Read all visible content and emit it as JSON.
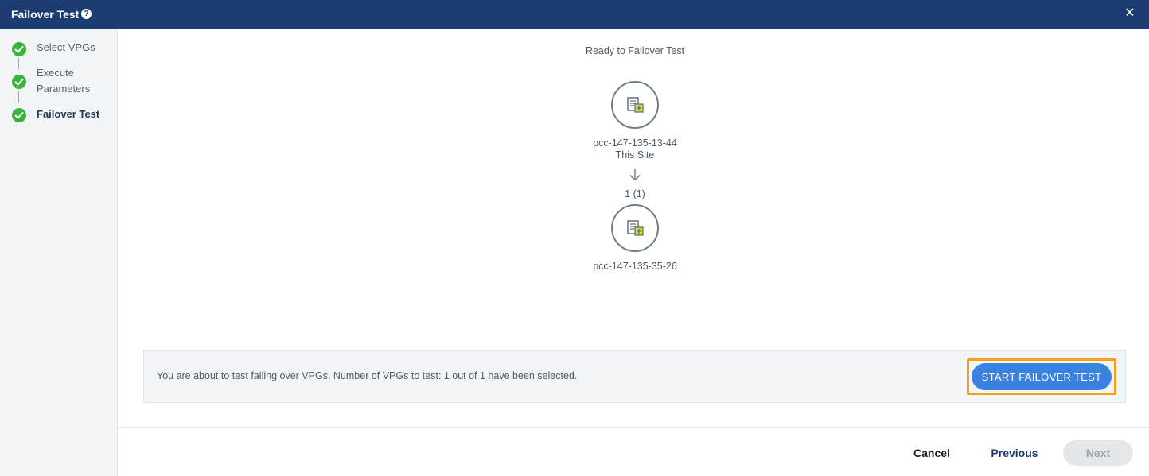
{
  "window": {
    "title": "Failover Test",
    "help_icon": "help-icon",
    "close_icon": "close-icon"
  },
  "steps": [
    {
      "label": "Select VPGs",
      "state": "complete"
    },
    {
      "label": "Execute Parameters",
      "state": "complete"
    },
    {
      "label": "Failover Test",
      "state": "complete-current"
    }
  ],
  "main": {
    "ready_text": "Ready to Failover Test",
    "source": {
      "name": "pcc-147-135-13-44",
      "subtitle": "This Site",
      "icon": "site-icon"
    },
    "arrow_icon": "arrow-down-icon",
    "vpg_count": "1 (1)",
    "target": {
      "name": "pcc-147-135-35-26",
      "icon": "site-icon"
    }
  },
  "info_bar": {
    "text": "You are about to test failing over VPGs. Number of VPGs to test: 1 out of 1 have been selected.",
    "start_button": "START FAILOVER TEST"
  },
  "footer": {
    "cancel": "Cancel",
    "previous": "Previous",
    "next": "Next"
  },
  "colors": {
    "titlebar": "#1c3b71",
    "step_complete": "#3cb43c",
    "primary_button": "#3b82e0",
    "highlight_outline": "#f5a01a",
    "disabled_button": "#e4e7ea"
  }
}
